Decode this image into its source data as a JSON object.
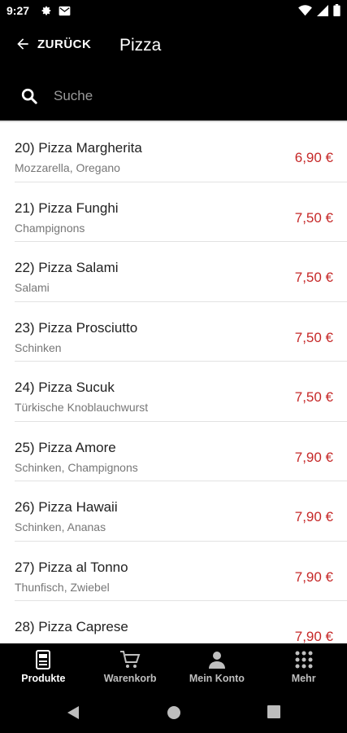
{
  "status_bar": {
    "time": "9:27"
  },
  "header": {
    "back_label": "ZURÜCK",
    "title": "Pizza"
  },
  "search": {
    "placeholder": "Suche"
  },
  "items": [
    {
      "name": "20) Pizza Margherita",
      "desc": "Mozzarella, Oregano",
      "price": "6,90 €"
    },
    {
      "name": "21) Pizza Funghi",
      "desc": "Champignons",
      "price": "7,50 €"
    },
    {
      "name": "22) Pizza Salami",
      "desc": "Salami",
      "price": "7,50 €"
    },
    {
      "name": "23) Pizza Prosciutto",
      "desc": "Schinken",
      "price": "7,50 €"
    },
    {
      "name": "24) Pizza Sucuk",
      "desc": "Türkische Knoblauchwurst",
      "price": "7,50 €"
    },
    {
      "name": "25) Pizza Amore",
      "desc": "Schinken, Champignons",
      "price": "7,90 €"
    },
    {
      "name": "26) Pizza Hawaii",
      "desc": "Schinken, Ananas",
      "price": "7,90 €"
    },
    {
      "name": "27) Pizza al Tonno",
      "desc": "Thunfisch, Zwiebel",
      "price": "7,90 €"
    },
    {
      "name": "28) Pizza Caprese",
      "desc": "",
      "price": "7,90 €"
    }
  ],
  "bottom_nav": [
    {
      "label": "Produkte",
      "icon": "menu-card-icon",
      "active": true
    },
    {
      "label": "Warenkorb",
      "icon": "cart-icon",
      "active": false
    },
    {
      "label": "Mein Konto",
      "icon": "person-icon",
      "active": false
    },
    {
      "label": "Mehr",
      "icon": "grid-icon",
      "active": false
    }
  ],
  "colors": {
    "background": "#000000",
    "list_background": "#ffffff",
    "price": "#c62828"
  }
}
